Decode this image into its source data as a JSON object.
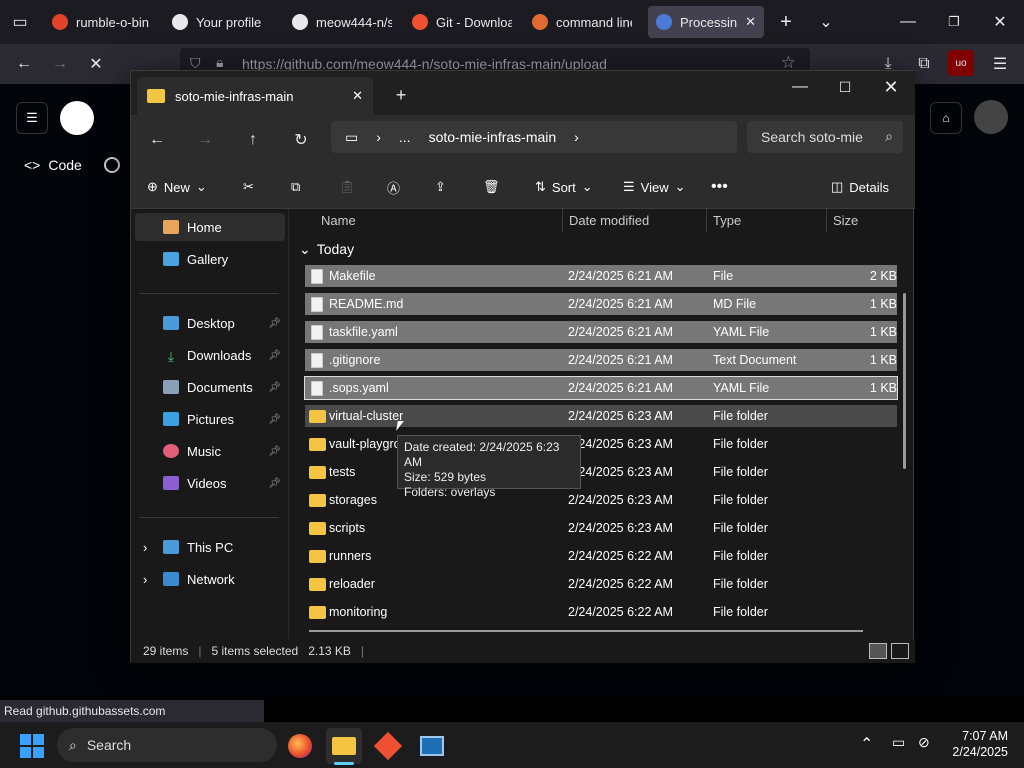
{
  "browser": {
    "tabs": [
      {
        "label": "rumble-o-bin",
        "color": "#e24329"
      },
      {
        "label": "Your profile",
        "color": "#e8e8ea"
      },
      {
        "label": "meow444-n/sc",
        "color": "#e8e8ea"
      },
      {
        "label": "Git - Downloa",
        "color": "#f05133"
      },
      {
        "label": "command line",
        "color": "#e06a2f"
      },
      {
        "label": "Processing",
        "color": "#4a7bd8",
        "active": true
      }
    ],
    "url": "https://github.com/meow444-n/soto-mie-infras-main/upload",
    "status_text": "Read github.githubassets.com",
    "github_code_tab": "Code"
  },
  "explorer": {
    "tab_title": "soto-mie-infras-main",
    "breadcrumb": [
      "...",
      "soto-mie-infras-main"
    ],
    "search_placeholder": "Search soto-mie",
    "commands": {
      "new": "New",
      "sort": "Sort",
      "view": "View",
      "details": "Details"
    },
    "nav": {
      "home": "Home",
      "gallery": "Gallery",
      "desktop": "Desktop",
      "downloads": "Downloads",
      "documents": "Documents",
      "pictures": "Pictures",
      "music": "Music",
      "videos": "Videos",
      "this_pc": "This PC",
      "network": "Network"
    },
    "columns": {
      "name": "Name",
      "date": "Date modified",
      "type": "Type",
      "size": "Size"
    },
    "group": "Today",
    "files": [
      {
        "name": "Makefile",
        "date": "2/24/2025 6:21 AM",
        "type": "File",
        "size": "2 KB",
        "kind": "file",
        "selected": true
      },
      {
        "name": "README.md",
        "date": "2/24/2025 6:21 AM",
        "type": "MD File",
        "size": "1 KB",
        "kind": "file",
        "selected": true
      },
      {
        "name": "taskfile.yaml",
        "date": "2/24/2025 6:21 AM",
        "type": "YAML File",
        "size": "1 KB",
        "kind": "file",
        "selected": true
      },
      {
        "name": ".gitignore",
        "date": "2/24/2025 6:21 AM",
        "type": "Text Document",
        "size": "1 KB",
        "kind": "file",
        "selected": true
      },
      {
        "name": ".sops.yaml",
        "date": "2/24/2025 6:21 AM",
        "type": "YAML File",
        "size": "1 KB",
        "kind": "file",
        "selected": true,
        "focus": true
      },
      {
        "name": "virtual-cluster",
        "date": "2/24/2025 6:23 AM",
        "type": "File folder",
        "size": "",
        "kind": "folder",
        "hover": true
      },
      {
        "name": "vault-playgro",
        "date": "2/24/2025 6:23 AM",
        "type": "File folder",
        "size": "",
        "kind": "folder"
      },
      {
        "name": "tests",
        "date": "2/24/2025 6:23 AM",
        "type": "File folder",
        "size": "",
        "kind": "folder"
      },
      {
        "name": "storages",
        "date": "2/24/2025 6:23 AM",
        "type": "File folder",
        "size": "",
        "kind": "folder"
      },
      {
        "name": "scripts",
        "date": "2/24/2025 6:23 AM",
        "type": "File folder",
        "size": "",
        "kind": "folder"
      },
      {
        "name": "runners",
        "date": "2/24/2025 6:22 AM",
        "type": "File folder",
        "size": "",
        "kind": "folder"
      },
      {
        "name": "reloader",
        "date": "2/24/2025 6:22 AM",
        "type": "File folder",
        "size": "",
        "kind": "folder"
      },
      {
        "name": "monitoring",
        "date": "2/24/2025 6:22 AM",
        "type": "File folder",
        "size": "",
        "kind": "folder"
      }
    ],
    "tooltip": {
      "line1": "Date created: 2/24/2025 6:23 AM",
      "line2": "Size: 529 bytes",
      "line3": "Folders: overlays"
    },
    "status": {
      "items": "29 items",
      "selected": "5 items selected",
      "size": "2.13 KB"
    }
  },
  "taskbar": {
    "search": "Search",
    "time": "7:07 AM",
    "date": "2/24/2025"
  }
}
